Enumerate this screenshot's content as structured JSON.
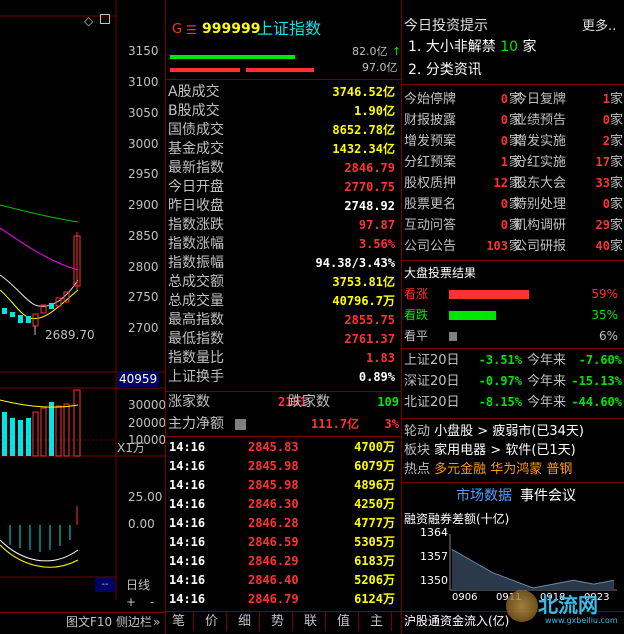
{
  "colors": {
    "up": "#ff3232",
    "down": "#00e600",
    "bg": "#000000",
    "grid": "#7a0000",
    "accent": "#ffff00",
    "cyan": "#00e5e5"
  },
  "chart_pane": {
    "price_axis": [
      "3150",
      "3100",
      "3050",
      "3000",
      "2950",
      "2900",
      "2850",
      "2800",
      "2750",
      "2700"
    ],
    "low_label": "2689.70",
    "vol_label": "40959",
    "vol_axis": [
      "30000",
      "20000",
      "10000"
    ],
    "vol_unit": "X1万",
    "ind_axis": [
      "25.00",
      "0.00"
    ],
    "period_button": "日线",
    "plus": "+",
    "minus": "-",
    "bottom_nav": "图文F10",
    "side_panel": "侧边栏",
    "more": "»",
    "icons": [
      "diamond-icon",
      "window-icon"
    ]
  },
  "quote": {
    "g_label": "G",
    "menu_icon": "menu-icon",
    "code": "999999",
    "name": "上证指数",
    "bar1_value": "82.0亿",
    "bar2_value": "97.0亿",
    "stats": [
      {
        "label": "A股成交",
        "value": "3746.52亿",
        "color": "y"
      },
      {
        "label": "B股成交",
        "value": "1.90亿",
        "color": "y"
      },
      {
        "label": "国债成交",
        "value": "8652.78亿",
        "color": "y"
      },
      {
        "label": "基金成交",
        "value": "1432.34亿",
        "color": "y"
      },
      {
        "label": "最新指数",
        "value": "2846.79",
        "color": "r"
      },
      {
        "label": "今日开盘",
        "value": "2770.75",
        "color": "r"
      },
      {
        "label": "昨日收盘",
        "value": "2748.92",
        "color": "w"
      },
      {
        "label": "指数涨跌",
        "value": "97.87",
        "color": "r"
      },
      {
        "label": "指数涨幅",
        "value": "3.56%",
        "color": "r"
      },
      {
        "label": "指数振幅",
        "value": "94.38/3.43%",
        "color": "w"
      },
      {
        "label": "总成交额",
        "value": "3753.81亿",
        "color": "y"
      },
      {
        "label": "总成交量",
        "value": "40796.7万",
        "color": "y"
      },
      {
        "label": "最高指数",
        "value": "2855.75",
        "color": "r"
      },
      {
        "label": "最低指数",
        "value": "2761.37",
        "color": "r"
      },
      {
        "label": "指数量比",
        "value": "1.83",
        "color": "r"
      },
      {
        "label": "上证换手",
        "value": "0.89%",
        "color": "w"
      }
    ],
    "up_label": "涨家数",
    "up_count": "2181",
    "down_label": "跌家数",
    "down_count": "109",
    "flow_label": "主力净额",
    "flow_value": "111.7亿",
    "flow_pct": "3%",
    "ticks": [
      {
        "time": "14:16",
        "price": "2845.83",
        "vol": "4700万"
      },
      {
        "time": "14:16",
        "price": "2845.98",
        "vol": "6079万"
      },
      {
        "time": "14:16",
        "price": "2845.98",
        "vol": "4896万"
      },
      {
        "time": "14:16",
        "price": "2846.30",
        "vol": "4250万"
      },
      {
        "time": "14:16",
        "price": "2846.28",
        "vol": "4777万"
      },
      {
        "time": "14:16",
        "price": "2846.59",
        "vol": "5305万"
      },
      {
        "time": "14:16",
        "price": "2846.29",
        "vol": "6183万"
      },
      {
        "time": "14:16",
        "price": "2846.40",
        "vol": "5206万"
      },
      {
        "time": "14:16",
        "price": "2846.79",
        "vol": "6124万"
      }
    ],
    "tabs": [
      "笔",
      "价",
      "细",
      "势",
      "联",
      "值",
      "主"
    ]
  },
  "right": {
    "tips_title": "今日投资提示",
    "more": "更多..",
    "tip1_prefix": "1. 大小非解禁",
    "tip1_count": "10",
    "tip1_suffix": "家",
    "tip2": "2. 分类资讯",
    "events": [
      {
        "l": "今始停牌",
        "lv": "0",
        "r": "今日复牌",
        "rv": "1"
      },
      {
        "l": "财报披露",
        "lv": "0",
        "r": "业绩预告",
        "rv": "0"
      },
      {
        "l": "增发预案",
        "lv": "0",
        "r": "增发实施",
        "rv": "2"
      },
      {
        "l": "分红预案",
        "lv": "1",
        "r": "分红实施",
        "rv": "17"
      },
      {
        "l": "股权质押",
        "lv": "12",
        "r": "股东大会",
        "rv": "33"
      },
      {
        "l": "股票更名",
        "lv": "0",
        "r": "特别处理",
        "rv": "0"
      },
      {
        "l": "互动问答",
        "lv": "0",
        "r": "机构调研",
        "rv": "29"
      },
      {
        "l": "公司公告",
        "lv": "103",
        "r": "公司研报",
        "rv": "40"
      }
    ],
    "unit": "家",
    "vote_title": "大盘投票结果",
    "votes": [
      {
        "label": "看涨",
        "pct": "59%",
        "frac": 0.59,
        "color": "#ff3232"
      },
      {
        "label": "看跌",
        "pct": "35%",
        "frac": 0.35,
        "color": "#00e600"
      },
      {
        "label": "看平",
        "pct": "6%",
        "frac": 0.06,
        "color": "#808080"
      }
    ],
    "index20": [
      {
        "name": "上证20日",
        "v": "-3.51%",
        "ytd_label": "今年来",
        "ytd": "-7.60%"
      },
      {
        "name": "深证20日",
        "v": "-0.97%",
        "ytd_label": "今年来",
        "ytd": "-15.13%"
      },
      {
        "name": "北证20日",
        "v": "-8.15%",
        "ytd_label": "今年来",
        "ytd": "-44.60%"
      }
    ],
    "rotation_label": "轮动",
    "rotation_value": "小盘股 > 疲弱市(已34天)",
    "sector_label": "板块",
    "sector_value": "家用电器 > 软件(已1天)",
    "hot_label": "热点",
    "hot_value": "多元金融 华为鸿蒙 普钢",
    "tab_market": "市场数据",
    "tab_events": "事件会议",
    "margin_title": "融资融券差额(十亿)",
    "margin_axis": [
      "1364",
      "1357",
      "1350"
    ],
    "margin_dates": [
      "0906",
      "0911",
      "0918",
      "0923"
    ],
    "hk_flow": "沪股通资金流入(亿)",
    "watermark": "北流网",
    "watermark_url": "www.gxbeiliu.com"
  },
  "chart_data": {
    "type": "line",
    "title": "融资融券差额(十亿)",
    "x": [
      "0906",
      "0911",
      "0918",
      "0923"
    ],
    "series": [
      {
        "values": [
          1360,
          1357,
          1354,
          1352,
          1350,
          1351,
          1352,
          1351,
          1352
        ]
      }
    ],
    "ylim": [
      1350,
      1364
    ]
  }
}
